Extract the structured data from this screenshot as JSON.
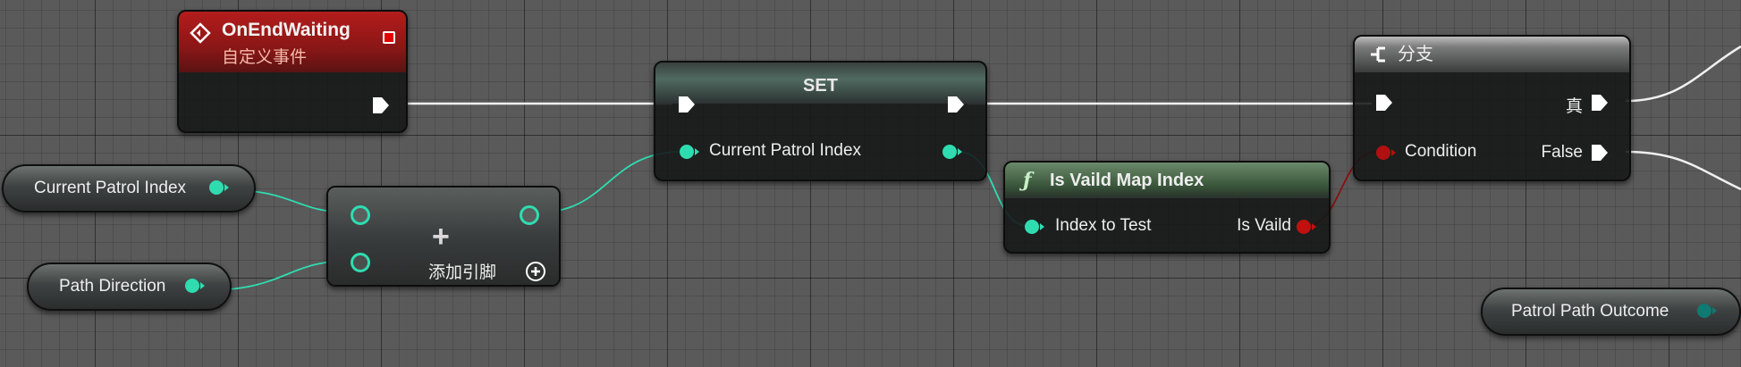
{
  "event_node": {
    "title": "OnEndWaiting",
    "subtitle": "自定义事件",
    "icon": "event-diamond-icon",
    "header_color": "#a21a1a"
  },
  "set_node": {
    "title": "SET",
    "input_label": "Current Patrol Index"
  },
  "branch_node": {
    "title": "分支",
    "true_label": "真",
    "condition_label": "Condition",
    "false_label": "False",
    "icon": "branch-icon"
  },
  "func_node": {
    "title": "Is Vaild Map Index",
    "icon": "function-icon",
    "input_label": "Index to Test",
    "output_label": "Is Vaild"
  },
  "add_node": {
    "symbol": "+",
    "add_pin_label": "添加引脚",
    "add_pin_icon": "add-circle-icon"
  },
  "var_current_patrol_index": {
    "label": "Current Patrol Index"
  },
  "var_path_direction": {
    "label": "Path Direction"
  },
  "var_patrol_path_outcome": {
    "label": "Patrol Path Outcome"
  },
  "colors": {
    "integer_pin": "#2fdcb0",
    "boolean_pin": "#b01010",
    "enum_pin": "#0f7a72",
    "exec_pin": "#ffffff",
    "grid_background": "#5a5a5a"
  }
}
